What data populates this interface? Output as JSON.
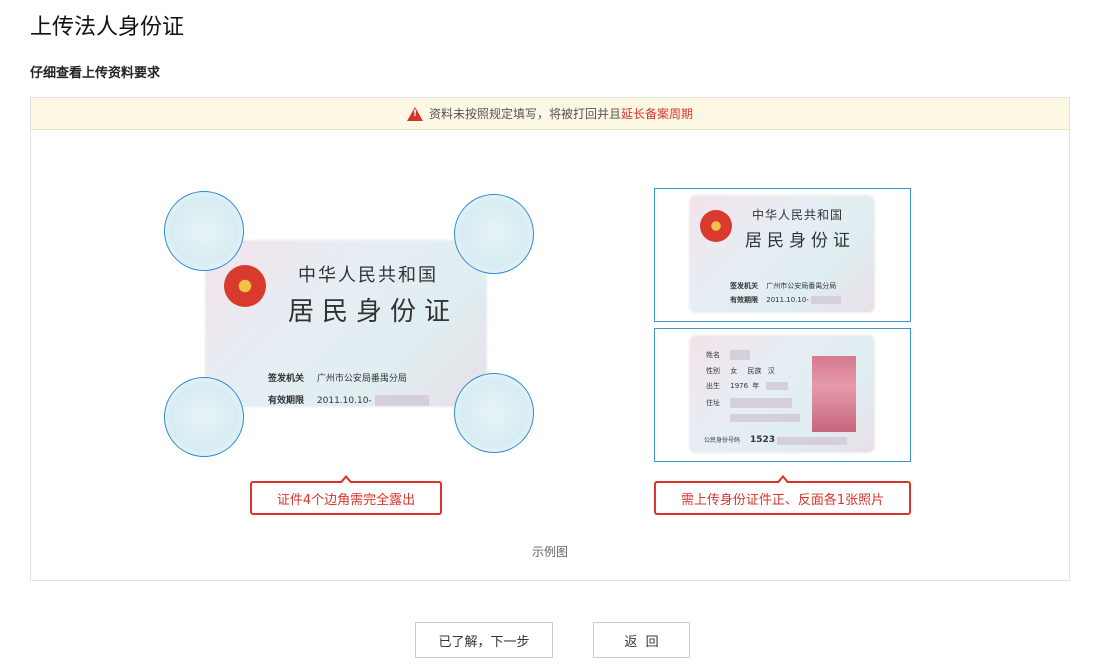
{
  "page": {
    "title": "上传法人身份证",
    "subtitle": "仔细查看上传资料要求"
  },
  "warning": {
    "icon": "warning-icon",
    "text": "资料未按照规定填写，将被打回并且",
    "link": "延长备案周期",
    "color": "#d9342b"
  },
  "example": {
    "card_front": {
      "line1": "中华人民共和国",
      "line2": "居民身份证",
      "authority_label": "签发机关",
      "authority_value": "广州市公安局番禺分局",
      "valid_label": "有效期限",
      "valid_value": "2011.10.10-"
    },
    "card_back": {
      "name_label": "姓名",
      "gender_label": "性别",
      "gender_value": "女",
      "ethnicity_label": "民族",
      "ethnicity_value": "汉",
      "birth_label": "出生",
      "birth_value": "1976",
      "year_unit": "年",
      "address_label": "住址",
      "id_label": "公民身份号码",
      "id_value": "1523"
    },
    "callout_left": "证件4个边角需完全露出",
    "callout_right": "需上传身份证件正、反面各1张照片",
    "caption": "示例图"
  },
  "buttons": {
    "confirm": "已了解，下一步",
    "back": "返  回"
  }
}
